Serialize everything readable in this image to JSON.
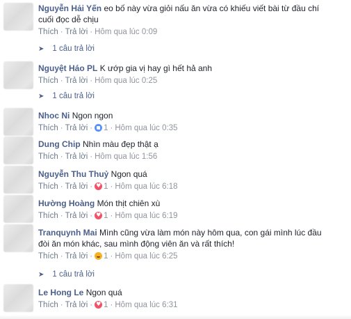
{
  "actions": {
    "like": "Thích",
    "reply": "Trả lời",
    "separator": "·"
  },
  "reply_icon": "reply-arrow-icon",
  "comments": [
    {
      "author": "Nguyễn Hải Yến",
      "text_line1": "eo bố này vừa giỏi nấu ăn vừa có khiếu viết bài từ đầu chí",
      "text_line2": "cuối đọc dễ chịu",
      "time": "Hôm qua lúc 0:09",
      "replies": "1 câu trả lời"
    },
    {
      "author": "Nguyệt Háo PL",
      "text_line1": "K ướp gia vị hay gì hết hả anh",
      "time": "Hôm qua lúc 0:25",
      "replies": "1 câu trả lời"
    },
    {
      "author": "Nhoc Ni",
      "text_line1": "Ngon ngon",
      "reaction": "like-reaction-icon",
      "reaction_count": "1",
      "time": "Hôm qua lúc 0:35"
    },
    {
      "author": "Dung Chip",
      "text_line1": "Nhìn màu đẹp thật ạ",
      "time": "Hôm qua lúc 1:56"
    },
    {
      "author": "Nguyễn Thu Thuỷ",
      "text_line1": "Ngon quá",
      "reaction": "love-reaction-icon",
      "reaction_count": "1",
      "time": "Hôm qua lúc 6:18"
    },
    {
      "author": "Hường Hoàng",
      "text_line1": "Món thịt chiên xù",
      "reaction": "love-reaction-icon",
      "reaction_count": "1",
      "time": "Hôm qua lúc 6:19"
    },
    {
      "author": "Tranquynh Mai",
      "text_line1": "Mình cũng vừa làm món này hôm qua, con gái mình lúc đầu",
      "text_line2": "đòi ăn món khác, sau mình động viên ăn và rất thích!",
      "reaction": "haha-reaction-icon",
      "reaction_count": "1",
      "time": "Hôm qua lúc 6:25",
      "replies": "1 câu trả lời"
    },
    {
      "author": "Le Hong Le",
      "text_line1": "Ngon quá",
      "reaction": "love-reaction-icon",
      "reaction_count": "1",
      "time": "Hôm qua lúc 6:31"
    }
  ]
}
